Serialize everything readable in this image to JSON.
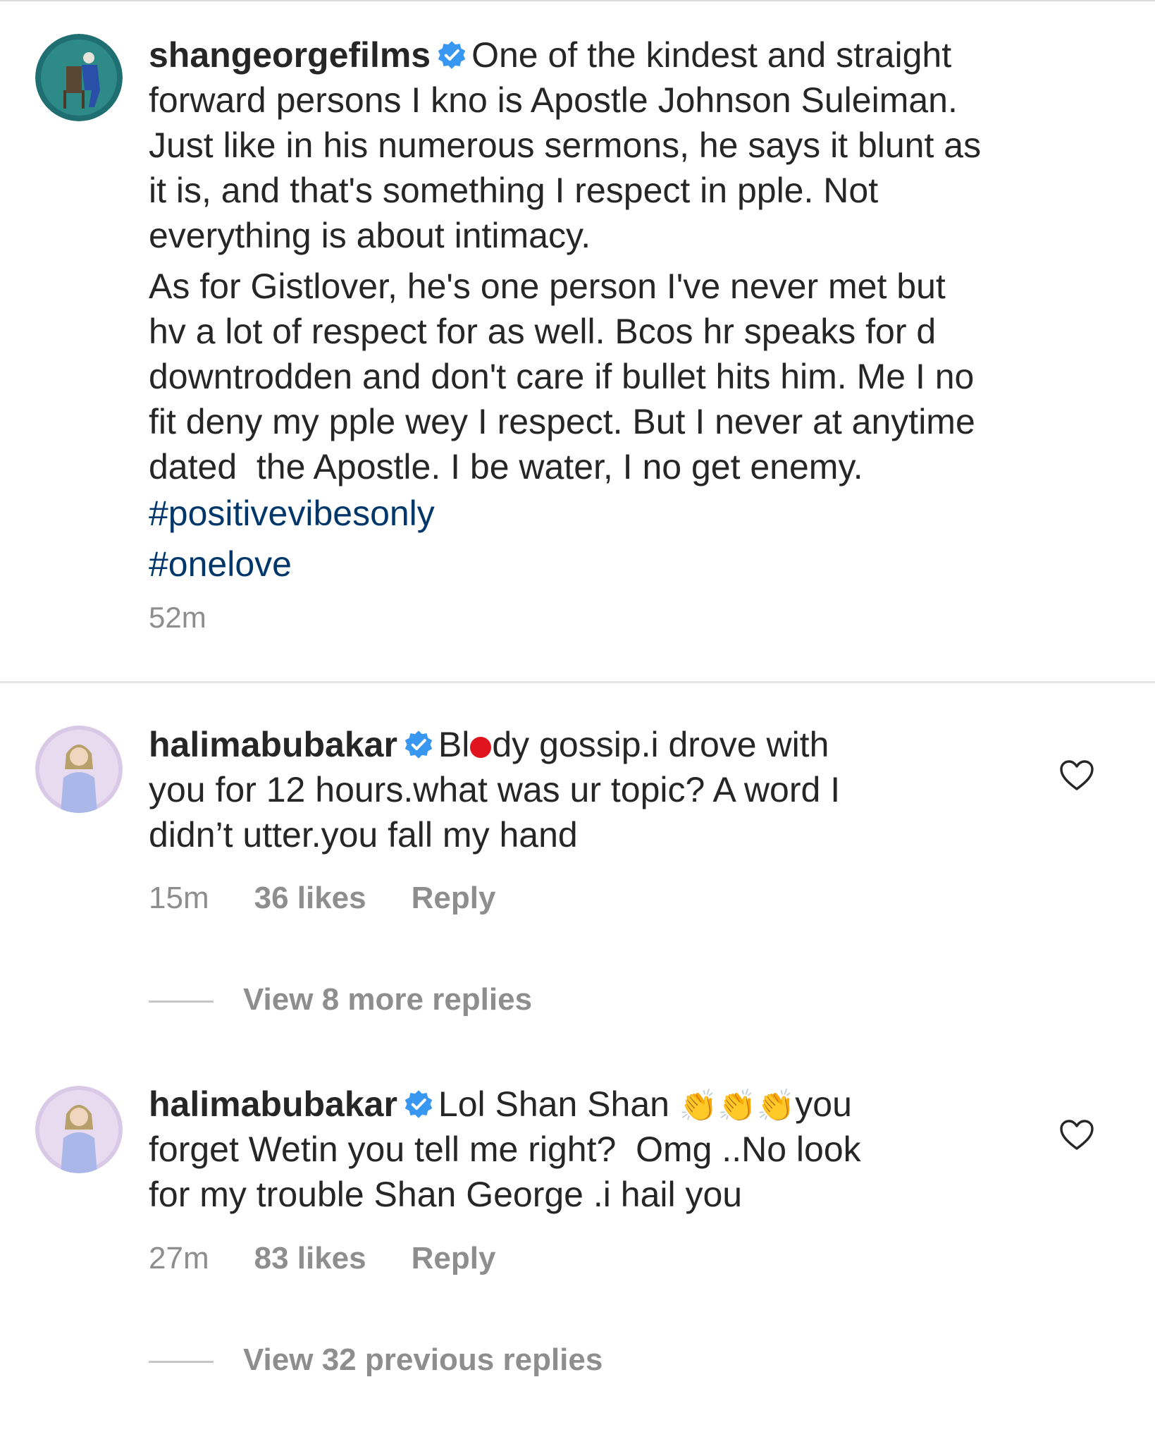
{
  "post": {
    "username": "shangeorgefilms",
    "lines_p1": [
      "One of the kindest and straight",
      "forward persons I kno is Apostle Johnson Suleiman.",
      "Just like in his numerous sermons, he says it blunt as",
      "it is, and that's something I respect in pple. Not",
      "everything is about intimacy."
    ],
    "lines_p2": [
      "As for Gistlover, he's one person I've never met but",
      "hv a lot of respect for as well. Bcos hr speaks for d",
      "downtrodden and don't care if bullet hits him. Me I no",
      "fit deny my pple wey I respect. But I never at anytime",
      "dated  the Apostle. I be water, I no get enemy."
    ],
    "hashtags": [
      "#positivevibesonly",
      "#onelove"
    ],
    "time": "52m"
  },
  "comments": [
    {
      "username": "halimabubakar",
      "text_before_dot": "Bl",
      "text_after_dot": "dy gossip.i drove with",
      "lines": [
        "you for 12 hours.what was ur topic? A word I",
        "didn’t utter.you fall my hand"
      ],
      "time": "15m",
      "likes": "36 likes",
      "reply": "Reply",
      "view_replies": "View 8 more replies"
    },
    {
      "username": "halimabubakar",
      "first_text": "Lol Shan Shan",
      "emoji": "👏",
      "after_emoji": "you",
      "lines": [
        "forget Wetin you tell me right?  Omg ..No look",
        "for my trouble Shan George .i hail you"
      ],
      "time": "27m",
      "likes": "83 likes",
      "reply": "Reply",
      "view_replies": "View 32 previous replies"
    }
  ],
  "colors": {
    "text": "#262626",
    "muted": "#8e8e8e",
    "hashtag": "#00376b",
    "verified": "#3897f0"
  }
}
